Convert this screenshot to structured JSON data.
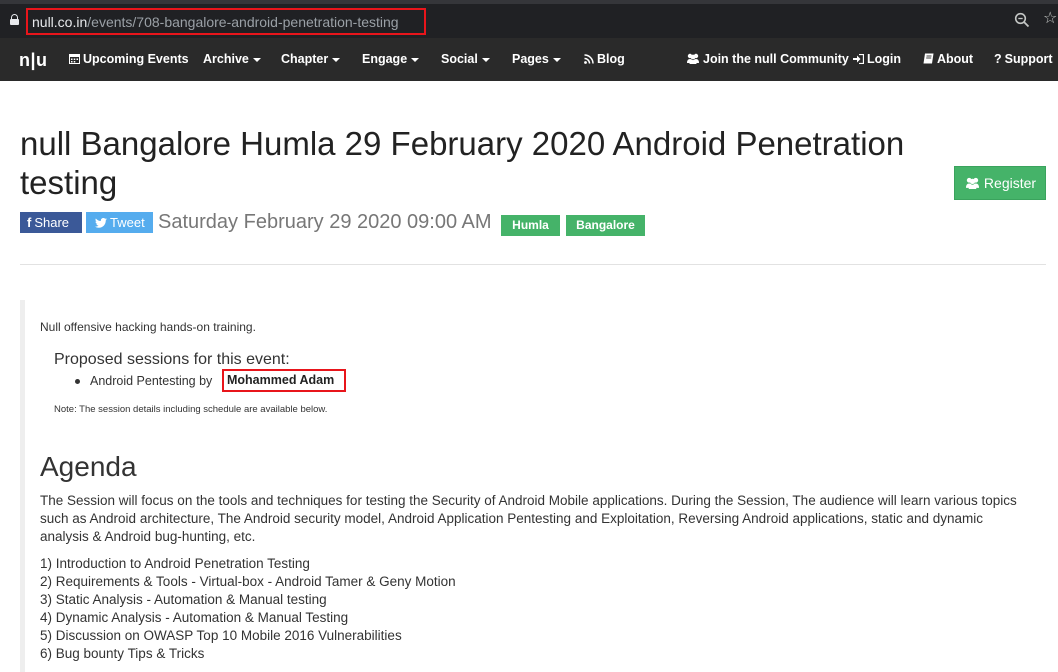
{
  "browser": {
    "url_host": "null.co.in",
    "url_path": "/events/708-bangalore-android-penetration-testing"
  },
  "navbar": {
    "brand": "n|u",
    "items": [
      {
        "label": "Upcoming Events",
        "icon": "calendar-icon",
        "dropdown": false
      },
      {
        "label": "Archive",
        "dropdown": true
      },
      {
        "label": "Chapter",
        "dropdown": true
      },
      {
        "label": "Engage",
        "dropdown": true
      },
      {
        "label": "Social",
        "dropdown": true
      },
      {
        "label": "Pages",
        "dropdown": true
      },
      {
        "label": "Blog",
        "icon": "rss-icon",
        "dropdown": false
      }
    ],
    "right_items": [
      {
        "label": "Join the null Community",
        "icon": "users-icon"
      },
      {
        "label": "Login",
        "icon": "sign-in-icon"
      },
      {
        "label": "About",
        "icon": "book-icon"
      },
      {
        "label": "Support",
        "icon": "question-icon"
      }
    ]
  },
  "event": {
    "title": "null Bangalore Humla 29 February 2020 Android Penetration testing",
    "register_label": "Register",
    "share_label": "Share",
    "tweet_label": "Tweet",
    "datetime": "Saturday February 29 2020 09:00 AM",
    "tags": [
      "Humla",
      "Bangalore"
    ],
    "intro": "Null offensive hacking hands-on training.",
    "sessions_heading": "Proposed sessions for this event:",
    "session_title": "Android Pentesting by",
    "session_speaker": "Mohammed Adam",
    "note": "Note: The session details including schedule are available below."
  },
  "agenda": {
    "heading": "Agenda",
    "description": "The Session will focus on the tools and techniques for testing the Security of Android Mobile applications. During the Session, The audience will learn various topics such as Android architecture, The Android security model, Android Application Pentesting and Exploitation, Reversing Android applications, static and dynamic analysis & Android bug-hunting, etc.",
    "items": [
      "1) Introduction to Android Penetration Testing",
      "2) Requirements & Tools - Virtual-box - Android Tamer & Geny Motion",
      "3) Static Analysis - Automation & Manual testing",
      "4) Dynamic Analysis - Automation & Manual Testing",
      "5) Discussion on OWASP Top 10 Mobile 2016 Vulnerabilities",
      "6) Bug bounty Tips & Tricks"
    ]
  },
  "colors": {
    "navbar_bg": "#2a2a2a",
    "success_green": "#45b369",
    "facebook_blue": "#3b5998",
    "twitter_blue": "#55acee",
    "highlight_red": "#e8151b"
  }
}
